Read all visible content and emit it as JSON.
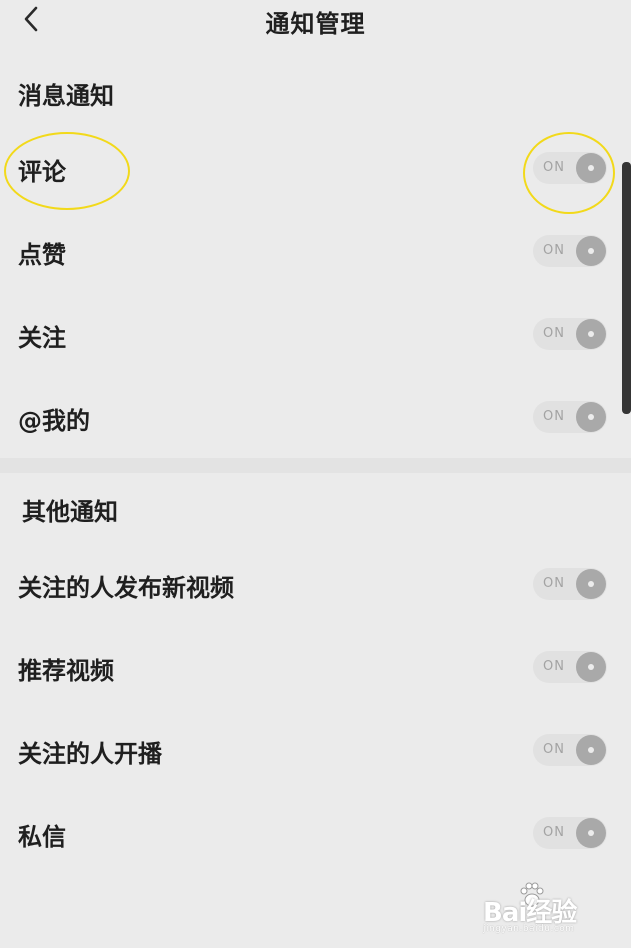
{
  "header": {
    "title": "通知管理",
    "back_icon": "chevron-left-icon"
  },
  "sections": [
    {
      "title": "消息通知",
      "items": [
        {
          "label": "评论",
          "toggle_text": "ON"
        },
        {
          "label": "点赞",
          "toggle_text": "ON"
        },
        {
          "label": "关注",
          "toggle_text": "ON"
        },
        {
          "label": "@我的",
          "toggle_text": "ON"
        }
      ]
    },
    {
      "title": "其他通知",
      "items": [
        {
          "label": "关注的人发布新视频",
          "toggle_text": "ON"
        },
        {
          "label": "推荐视频",
          "toggle_text": "ON"
        },
        {
          "label": "关注的人开播",
          "toggle_text": "ON"
        },
        {
          "label": "私信",
          "toggle_text": "ON"
        }
      ]
    }
  ],
  "watermark": {
    "brand": "Bai经验",
    "url": "jingyan.baidu.com"
  },
  "colors": {
    "background": "#ebebeb",
    "highlight": "#f2d91a",
    "toggle_track": "#e1e1e1",
    "toggle_knob": "#a9a9a9"
  }
}
